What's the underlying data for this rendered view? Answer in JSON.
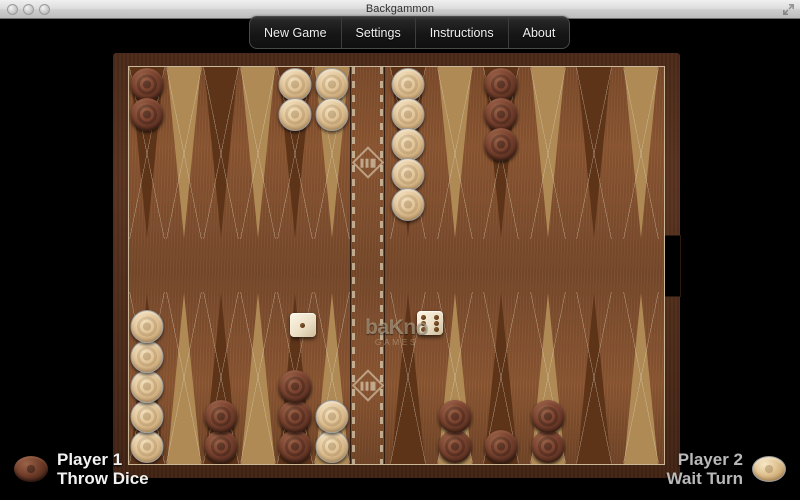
{
  "window": {
    "title": "Backgammon",
    "traffic_lights": [
      "close-button",
      "minimize-button",
      "zoom-button"
    ],
    "fullscreen_icon": "fullscreen-icon"
  },
  "menu": {
    "items": [
      {
        "label": "New Game"
      },
      {
        "label": "Settings"
      },
      {
        "label": "Instructions"
      },
      {
        "label": "About"
      }
    ]
  },
  "logo": {
    "main": "baKno",
    "sub": "GAMES"
  },
  "dice": [
    {
      "name": "left-die",
      "value": 1
    },
    {
      "name": "right-die",
      "value": 6
    }
  ],
  "players": [
    {
      "id": "player-1",
      "name": "Player 1",
      "status": "Throw Dice",
      "checker": "dark",
      "active": true
    },
    {
      "id": "player-2",
      "name": "Player 2",
      "status": "Wait Turn",
      "checker": "light",
      "active": false
    }
  ],
  "colors": {
    "point_light": "#b08a55",
    "point_dark": "#5e3419",
    "board_wood": "#8a5531",
    "frame": "#4b2a19",
    "checker_dark": "#7d4531",
    "checker_light": "#e3c79b",
    "background": "#000000",
    "menu_text": "#efefef"
  },
  "board": {
    "top_points": [
      {
        "index": 1,
        "color": "dark",
        "count": 2
      },
      {
        "index": 2,
        "color": null,
        "count": 0
      },
      {
        "index": 3,
        "color": null,
        "count": 0
      },
      {
        "index": 4,
        "color": null,
        "count": 0
      },
      {
        "index": 5,
        "color": "light",
        "count": 2
      },
      {
        "index": 6,
        "color": "light",
        "count": 2
      },
      {
        "index": 7,
        "color": "light",
        "count": 5
      },
      {
        "index": 8,
        "color": null,
        "count": 0
      },
      {
        "index": 9,
        "color": "dark",
        "count": 3
      },
      {
        "index": 10,
        "color": null,
        "count": 0
      },
      {
        "index": 11,
        "color": null,
        "count": 0
      },
      {
        "index": 12,
        "color": null,
        "count": 0
      }
    ],
    "bottom_points": [
      {
        "index": 13,
        "color": "light",
        "count": 5
      },
      {
        "index": 14,
        "color": null,
        "count": 0
      },
      {
        "index": 15,
        "color": "dark",
        "count": 2
      },
      {
        "index": 16,
        "color": null,
        "count": 0
      },
      {
        "index": 17,
        "color": "dark",
        "count": 3
      },
      {
        "index": 18,
        "color": "light",
        "count": 2
      },
      {
        "index": 19,
        "color": null,
        "count": 0
      },
      {
        "index": 20,
        "color": "dark",
        "count": 2
      },
      {
        "index": 21,
        "color": "dark",
        "count": 1
      },
      {
        "index": 22,
        "color": "dark",
        "count": 2
      },
      {
        "index": 23,
        "color": null,
        "count": 0
      },
      {
        "index": 24,
        "color": null,
        "count": 0
      }
    ]
  }
}
